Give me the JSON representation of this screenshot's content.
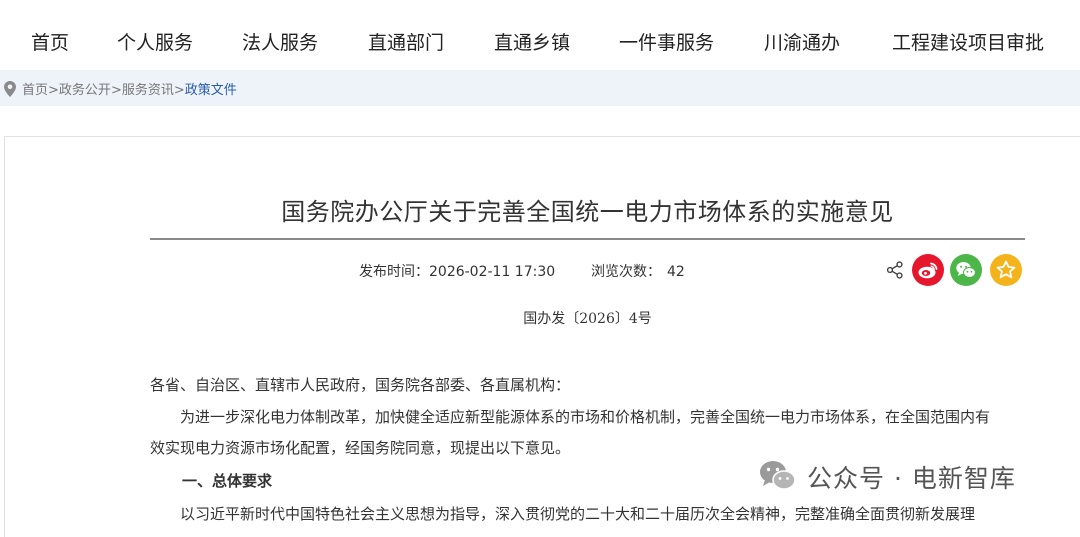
{
  "nav": {
    "items": [
      "首页",
      "个人服务",
      "法人服务",
      "直通部门",
      "直通乡镇",
      "一件事服务",
      "川渝通办",
      "工程建设项目审批"
    ]
  },
  "breadcrumb": {
    "home": "首页",
    "sep": ">",
    "level1": "政务公开",
    "level2": "服务资讯",
    "current": "政策文件"
  },
  "article": {
    "title": "国务院办公厅关于完善全国统一电力市场体系的实施意见",
    "publish_label": "发布时间：",
    "publish_time": "2026-02-11 17:30",
    "views_label": "浏览次数：",
    "views": "42",
    "doc_number": "国办发〔2026〕4号",
    "paragraphs": {
      "salutation": "各省、自治区、直辖市人民政府，国务院各部委、各直属机构：",
      "intro_line1": "为进一步深化电力体制改革，加快健全适应新型能源体系的市场和价格机制，完善全国统一电力市场体系，在全国范围内有",
      "intro_line2": "效实现电力资源市场化配置，经国务院同意，现提出以下意见。",
      "section1_heading": "一、总体要求",
      "section1_line1": "以习近平新时代中国特色社会主义思想为指导，深入贯彻党的二十大和二十届历次全会精神，完整准确全面贯彻新发展理"
    }
  },
  "share": {
    "icons": [
      "share-icon",
      "weibo-icon",
      "wechat-icon",
      "favorite-star-icon"
    ],
    "colors": {
      "weibo": "#e6162d",
      "wechat": "#4cb748",
      "star": "#f5b31b"
    }
  },
  "watermark": {
    "text": "公众号 · 电新智库"
  }
}
